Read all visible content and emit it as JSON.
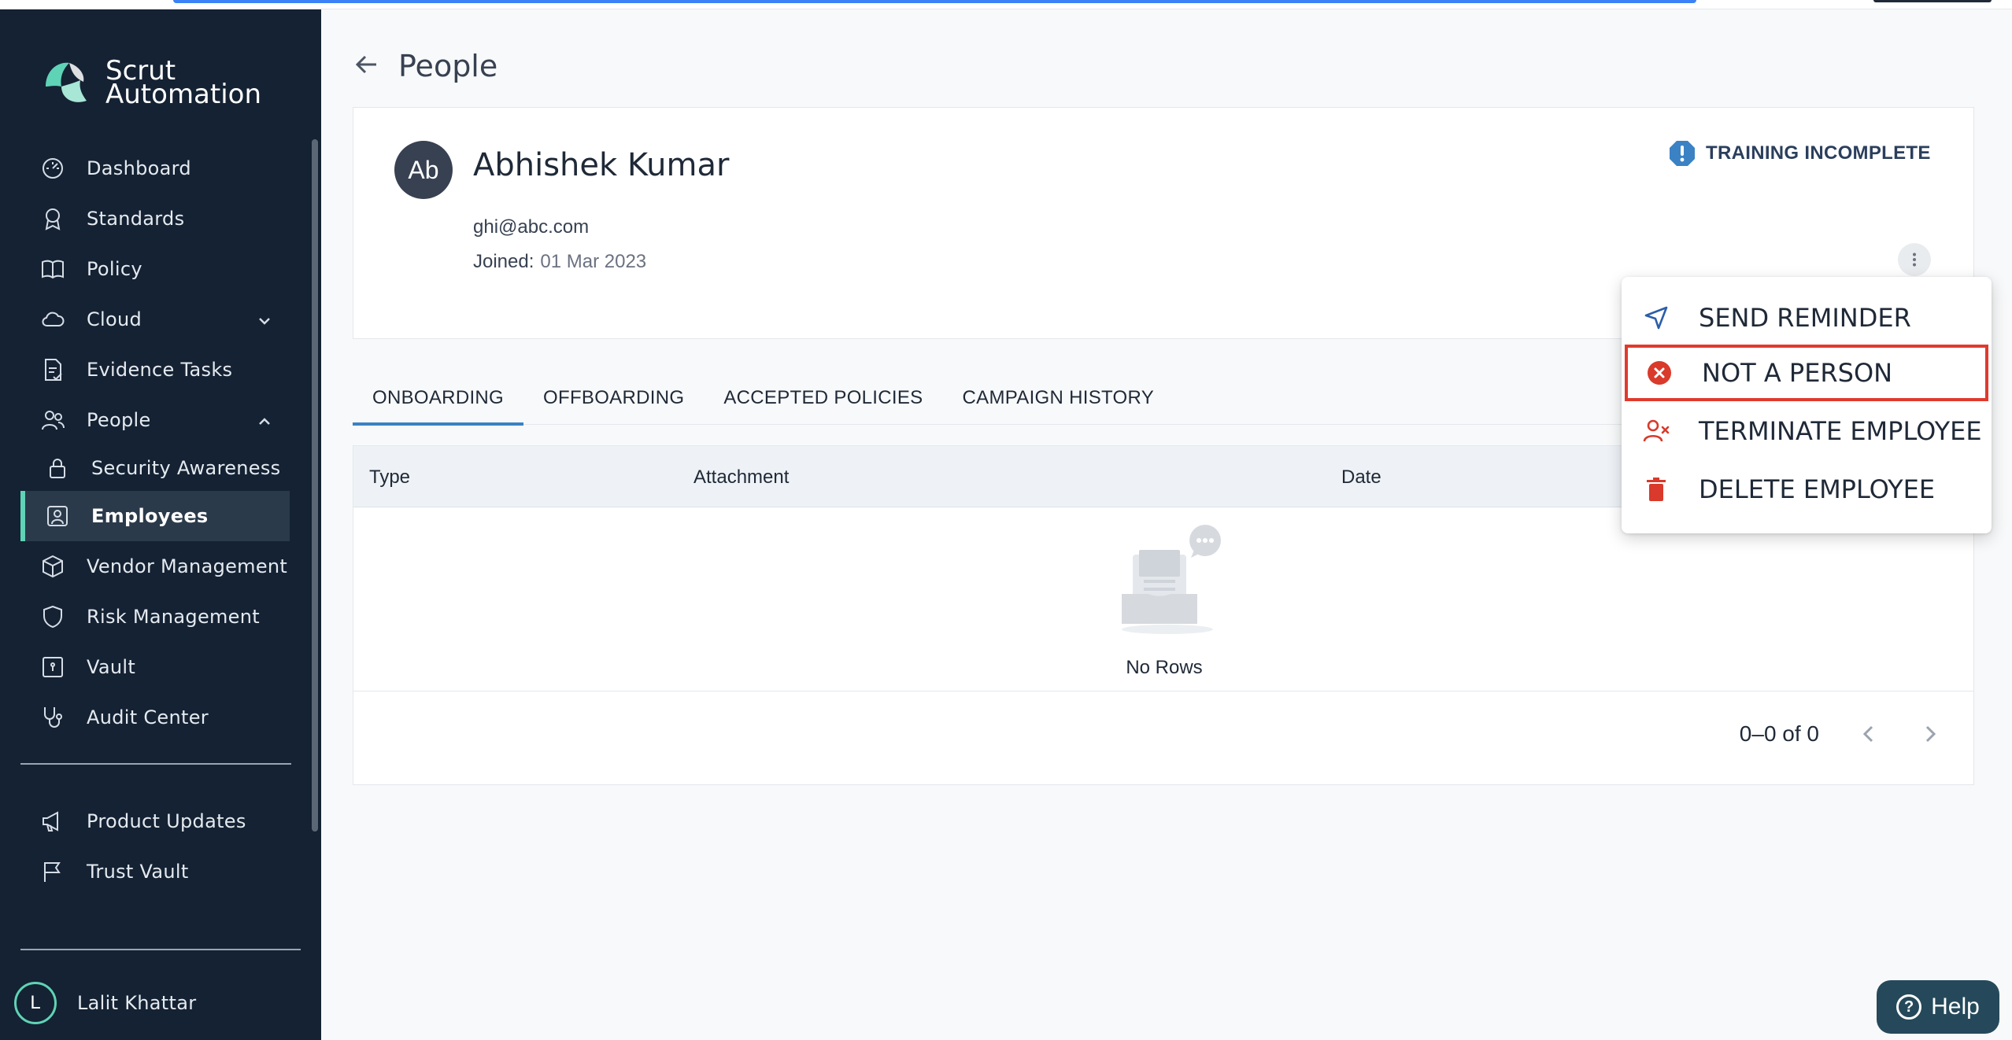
{
  "app": {
    "logo_line1": "Scrut",
    "logo_line2": "Automation"
  },
  "sidebar": {
    "items": [
      {
        "label": "Dashboard",
        "icon": "dashboard-icon"
      },
      {
        "label": "Standards",
        "icon": "award-icon"
      },
      {
        "label": "Policy",
        "icon": "book-icon"
      },
      {
        "label": "Cloud",
        "icon": "cloud-icon"
      },
      {
        "label": "Evidence Tasks",
        "icon": "file-check-icon"
      },
      {
        "label": "People",
        "icon": "users-icon"
      },
      {
        "label": "Security Awareness",
        "icon": "lock-icon"
      },
      {
        "label": "Employees",
        "icon": "employee-badge-icon"
      },
      {
        "label": "Vendor Management",
        "icon": "package-icon"
      },
      {
        "label": "Risk Management",
        "icon": "shield-icon"
      },
      {
        "label": "Vault",
        "icon": "vault-icon"
      },
      {
        "label": "Audit Center",
        "icon": "stethoscope-icon"
      }
    ],
    "bottom_items": [
      {
        "label": "Product Updates",
        "icon": "megaphone-icon"
      },
      {
        "label": "Trust Vault",
        "icon": "flag-icon"
      }
    ],
    "user": {
      "initial": "L",
      "name": "Lalit Khattar"
    }
  },
  "page": {
    "title": "People"
  },
  "profile": {
    "initials": "Ab",
    "name": "Abhishek Kumar",
    "email": "ghi@abc.com",
    "joined_label": "Joined:",
    "joined_value": "01 Mar 2023",
    "badge": "TRAINING INCOMPLETE"
  },
  "tabs": [
    "ONBOARDING",
    "OFFBOARDING",
    "ACCEPTED POLICIES",
    "CAMPAIGN HISTORY"
  ],
  "table": {
    "columns": [
      "Type",
      "Attachment",
      "Date"
    ],
    "empty_text": "No Rows",
    "pagination": "0–0 of 0"
  },
  "menu": {
    "items": [
      "SEND REMINDER",
      "NOT A PERSON",
      "TERMINATE EMPLOYEE",
      "DELETE EMPLOYEE"
    ]
  },
  "help": {
    "label": "Help"
  },
  "colors": {
    "sidebar_bg": "#142233",
    "accent": "#5fd3b5",
    "highlight_border": "#e03a2e",
    "tab_underline": "#3b82c4"
  }
}
